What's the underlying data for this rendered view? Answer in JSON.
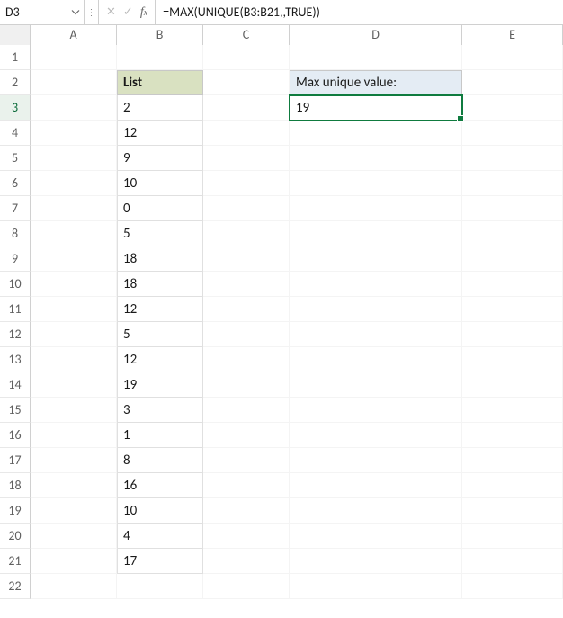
{
  "name_box": "D3",
  "formula": "=MAX(UNIQUE(B3:B21,,TRUE))",
  "columns": [
    "A",
    "B",
    "C",
    "D",
    "E"
  ],
  "rows": [
    1,
    2,
    3,
    4,
    5,
    6,
    7,
    8,
    9,
    10,
    11,
    12,
    13,
    14,
    15,
    16,
    17,
    18,
    19,
    20,
    21,
    22
  ],
  "list": {
    "header": "List",
    "values": [
      2,
      12,
      9,
      10,
      0,
      5,
      18,
      18,
      12,
      5,
      12,
      19,
      3,
      1,
      8,
      16,
      10,
      4,
      17
    ]
  },
  "max_block": {
    "header": "Max unique value:",
    "value": 19
  },
  "selected_cell": "D3",
  "chart_data": {
    "type": "table",
    "title": "List",
    "categories": [
      "B3",
      "B4",
      "B5",
      "B6",
      "B7",
      "B8",
      "B9",
      "B10",
      "B11",
      "B12",
      "B13",
      "B14",
      "B15",
      "B16",
      "B17",
      "B18",
      "B19",
      "B20",
      "B21"
    ],
    "values": [
      2,
      12,
      9,
      10,
      0,
      5,
      18,
      18,
      12,
      5,
      12,
      19,
      3,
      1,
      8,
      16,
      10,
      4,
      17
    ],
    "result_label": "Max unique value:",
    "result_value": 19
  }
}
